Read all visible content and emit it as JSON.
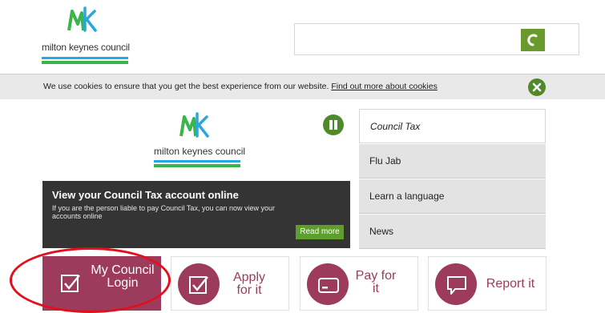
{
  "header": {
    "logo_text": "milton keynes council",
    "search": {
      "value": "",
      "placeholder": ""
    }
  },
  "cookie_bar": {
    "text": "We use cookies to ensure that you get the best experience from our website.",
    "link_label": "Find out more about cookies"
  },
  "banner": {
    "logo_text": "milton keynes council",
    "promo": {
      "title": "View your Council Tax account online",
      "body": "If you are the person liable to pay Council Tax, you can now view your accounts online",
      "read_more": "Read more"
    }
  },
  "tabs": [
    {
      "label": "Council Tax"
    },
    {
      "label": "Flu Jab"
    },
    {
      "label": "Learn a language"
    },
    {
      "label": "News"
    }
  ],
  "quick_links": {
    "login": "My Council Login",
    "apply": "Apply for it",
    "pay": "Pay for it",
    "report": "Report it"
  },
  "colors": {
    "brand_plum": "#9c3b5b",
    "brand_green": "#4f8a2a",
    "highlight_red": "#e0101c"
  }
}
